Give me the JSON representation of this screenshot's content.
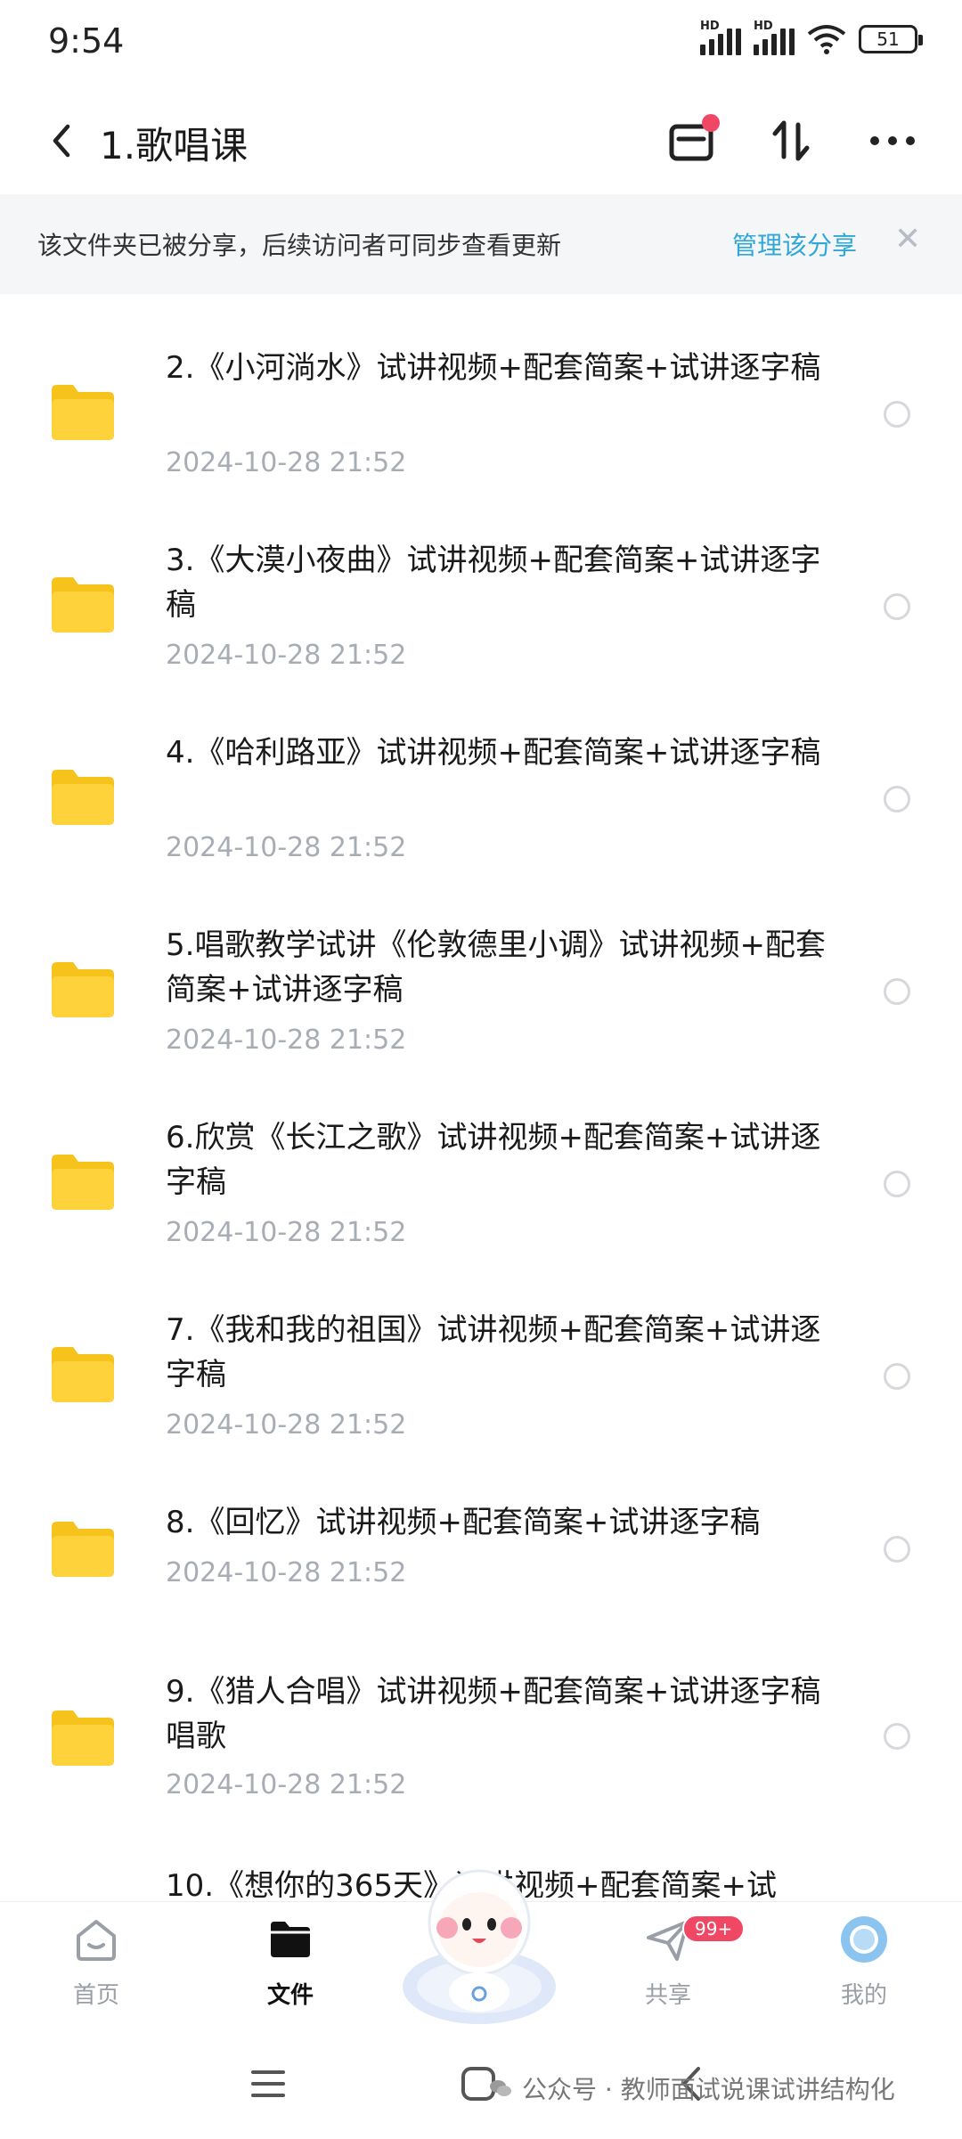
{
  "status_bar": {
    "time": "9:54",
    "network_labels": [
      "HD",
      "HD"
    ],
    "battery": "51"
  },
  "header": {
    "title": "1.歌唱课"
  },
  "banner": {
    "text": "该文件夹已被分享，后续访问者可同步查看更新",
    "link": "管理该分享",
    "close": "✕"
  },
  "files": [
    {
      "name": "2.《小河淌水》试讲视频+配套简案+试讲逐字稿",
      "date": "2024-10-28  21:52"
    },
    {
      "name": "3.《大漠小夜曲》试讲视频+配套简案+试讲逐字稿",
      "date": "2024-10-28  21:52"
    },
    {
      "name": "4.《哈利路亚》试讲视频+配套简案+试讲逐字稿",
      "date": "2024-10-28  21:52"
    },
    {
      "name": "5.唱歌教学试讲《伦敦德里小调》试讲视频+配套简案+试讲逐字稿",
      "date": "2024-10-28  21:52"
    },
    {
      "name": "6.欣赏《长江之歌》试讲视频+配套简案+试讲逐字稿",
      "date": "2024-10-28  21:52"
    },
    {
      "name": "7.《我和我的祖国》试讲视频+配套简案+试讲逐字稿",
      "date": "2024-10-28  21:52"
    },
    {
      "name": "8.《回忆》试讲视频+配套简案+试讲逐字稿",
      "date": "2024-10-28  21:52"
    },
    {
      "name": "9.《猎人合唱》试讲视频+配套简案+试讲逐字稿唱歌",
      "date": "2024-10-28  21:52"
    },
    {
      "name": "10.《想你的365天》试讲视频+配套简案+试",
      "date": ""
    }
  ],
  "bottom_nav": {
    "items": [
      {
        "label": "首页",
        "icon": "home-icon"
      },
      {
        "label": "文件",
        "icon": "folder-icon"
      },
      {
        "label": "共享",
        "icon": "send-icon"
      },
      {
        "label": "我的",
        "icon": "avatar-icon"
      }
    ],
    "share_badge": "99+"
  },
  "watermark": "公众号 · 教师面试说课试讲结构化",
  "colors": {
    "accent": "#2fa8d8",
    "badge": "#f04864",
    "folder": "#fdd23a"
  }
}
